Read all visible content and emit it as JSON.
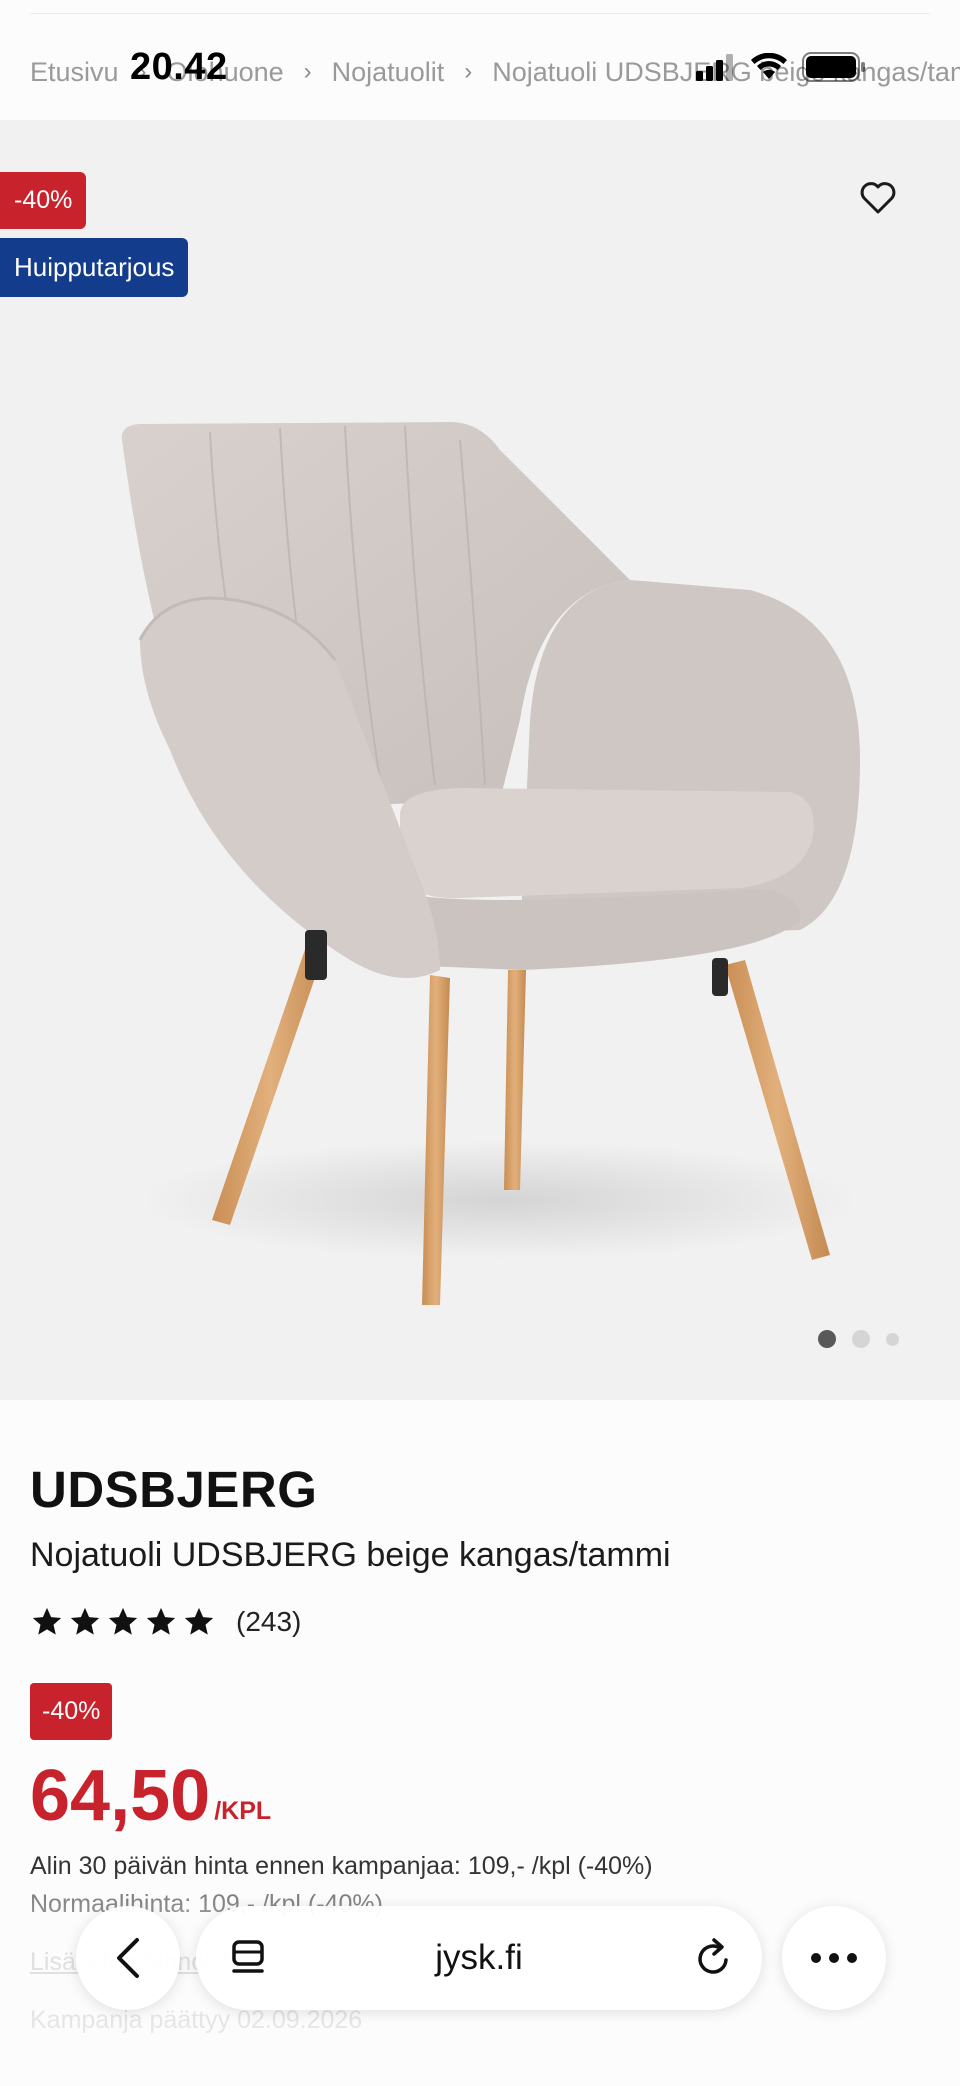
{
  "status_bar": {
    "time": "20.42"
  },
  "breadcrumb": {
    "items": [
      "Etusivu",
      "Olohuone",
      "Nojatuolit",
      "Nojatuoli UDSBJERG beige kangas/tammi"
    ]
  },
  "hero": {
    "discount_badge": "-40%",
    "offer_badge": "Huipputarjous",
    "favorite_icon": "heart-outline-icon",
    "image_count": 3,
    "active_image": 1
  },
  "product": {
    "brand": "UDSBJERG",
    "name": "Nojatuoli UDSBJERG beige kangas/tammi",
    "rating": {
      "stars": 5,
      "count": "(243)"
    },
    "discount_badge": "-40%",
    "price": "64,50",
    "price_unit": "/KPL",
    "prev_price_text": "Alin 30 päivän hinta ennen kampanjaa: 109,- /kpl (-40%)",
    "normal_price_text": "Normaalihinta: 109,- /kpl (-40%)",
    "more_info_link": "Lisätietoa hinnoista",
    "campaign_end": "Kampanja päättyy 02.09.2026"
  },
  "browser_bar": {
    "url": "jysk.fi",
    "back_icon": "chevron-left-icon",
    "tabs_icon": "tabs-icon",
    "reload_icon": "reload-icon",
    "more_icon": "more-dots-icon"
  },
  "colors": {
    "accent_red": "#c8232c",
    "offer_blue": "#143c8c",
    "hero_bg": "#f2f1f1"
  }
}
